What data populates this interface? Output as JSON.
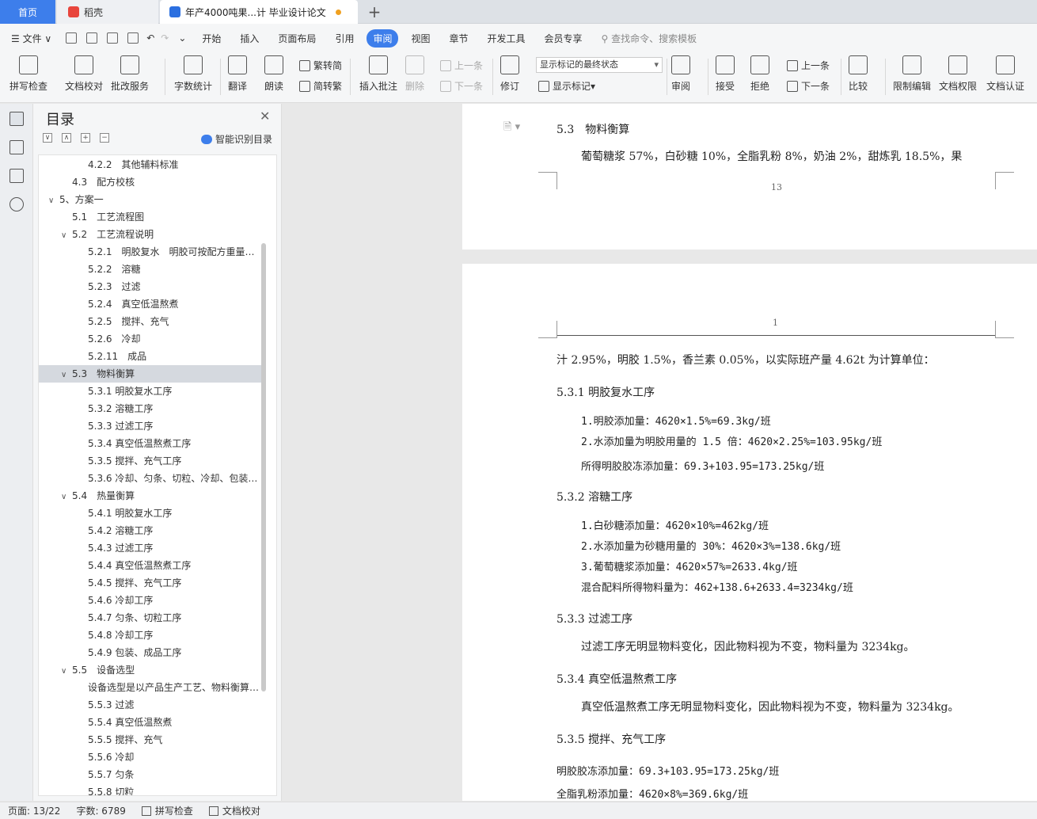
{
  "tabs": {
    "home": "首页",
    "daoke": "稻壳",
    "doc": "年产4000吨果...计 毕业设计论文"
  },
  "menu": [
    "文件",
    "开始",
    "插入",
    "页面布局",
    "引用",
    "审阅",
    "视图",
    "章节",
    "开发工具",
    "会员专享"
  ],
  "menu_search": "查找命令、搜索模板",
  "ribbon": {
    "spell": "拼写检查",
    "proof": "文档校对",
    "batch": "批改服务",
    "wordcount": "字数统计",
    "translate": "翻译",
    "read": "朗读",
    "trad": "繁转简",
    "simp": "简转繁",
    "insert_comment": "插入批注",
    "delete": "删除",
    "prev1": "上一条",
    "next1": "下一条",
    "revise": "修订",
    "markup_state": "显示标记的最终状态",
    "show_markup": "显示标记",
    "review": "审阅",
    "accept": "接受",
    "reject": "拒绝",
    "prev2": "上一条",
    "next2": "下一条",
    "compare": "比较",
    "restrict": "限制编辑",
    "rights": "文档权限",
    "certify": "文档认证"
  },
  "toc": {
    "title": "目录",
    "smart": "智能识别目录",
    "items": [
      {
        "text": "4.2.2　其他辅料标准",
        "level": 3,
        "caret": ""
      },
      {
        "text": "4.3　配方校核",
        "level": 2,
        "caret": ""
      },
      {
        "text": "5、方案一",
        "level": 1,
        "caret": "∨"
      },
      {
        "text": "5.1　工艺流程图",
        "level": 2,
        "caret": ""
      },
      {
        "text": "5.2　工艺流程说明",
        "level": 2,
        "caret": "∨"
      },
      {
        "text": "5.2.1　明胶复水　明胶可按配方重量…",
        "level": 3,
        "caret": ""
      },
      {
        "text": "5.2.2　溶糖",
        "level": 3,
        "caret": ""
      },
      {
        "text": "5.2.3　过滤",
        "level": 3,
        "caret": ""
      },
      {
        "text": "5.2.4　真空低温熬煮",
        "level": 3,
        "caret": ""
      },
      {
        "text": "5.2.5　搅拌、充气",
        "level": 3,
        "caret": ""
      },
      {
        "text": "5.2.6　冷却",
        "level": 3,
        "caret": ""
      },
      {
        "text": "5.2.11　成品",
        "level": 3,
        "caret": ""
      },
      {
        "text": "5.3　物料衡算",
        "level": 2,
        "caret": "∨"
      },
      {
        "text": "5.3.1 明胶复水工序",
        "level": 3,
        "caret": ""
      },
      {
        "text": "5.3.2 溶糖工序",
        "level": 3,
        "caret": ""
      },
      {
        "text": "5.3.3 过滤工序",
        "level": 3,
        "caret": ""
      },
      {
        "text": "5.3.4 真空低温熬煮工序",
        "level": 3,
        "caret": ""
      },
      {
        "text": "5.3.5 搅拌、充气工序",
        "level": 3,
        "caret": ""
      },
      {
        "text": "5.3.6 冷却、匀条、切粒、冷却、包装…",
        "level": 3,
        "caret": ""
      },
      {
        "text": "5.4　热量衡算",
        "level": 2,
        "caret": "∨"
      },
      {
        "text": "5.4.1 明胶复水工序",
        "level": 3,
        "caret": ""
      },
      {
        "text": "5.4.2 溶糖工序",
        "level": 3,
        "caret": ""
      },
      {
        "text": "5.4.3 过滤工序",
        "level": 3,
        "caret": ""
      },
      {
        "text": "5.4.4 真空低温熬煮工序",
        "level": 3,
        "caret": ""
      },
      {
        "text": "5.4.5 搅拌、充气工序",
        "level": 3,
        "caret": ""
      },
      {
        "text": "5.4.6 冷却工序",
        "level": 3,
        "caret": ""
      },
      {
        "text": "5.4.7 匀条、切粒工序",
        "level": 3,
        "caret": ""
      },
      {
        "text": "5.4.8 冷却工序",
        "level": 3,
        "caret": ""
      },
      {
        "text": "5.4.9 包装、成品工序",
        "level": 3,
        "caret": ""
      },
      {
        "text": "5.5　设备选型",
        "level": 2,
        "caret": "∨"
      },
      {
        "text": "设备选型是以产品生产工艺、物料衡算…",
        "level": 3,
        "caret": ""
      },
      {
        "text": "5.5.3 过滤",
        "level": 3,
        "caret": ""
      },
      {
        "text": "5.5.4 真空低温熬煮",
        "level": 3,
        "caret": ""
      },
      {
        "text": "5.5.5 搅拌、充气",
        "level": 3,
        "caret": ""
      },
      {
        "text": "5.5.6 冷却",
        "level": 3,
        "caret": ""
      },
      {
        "text": "5.5.7 匀条",
        "level": 3,
        "caret": ""
      },
      {
        "text": "5.5.8 切粒",
        "level": 3,
        "caret": ""
      }
    ],
    "selected_index": 12
  },
  "page1": {
    "heading": "5.3　物料衡算",
    "line": "葡萄糖浆 57%，白砂糖 10%，全脂乳粉 8%，奶油 2%，甜炼乳 18.5%，果",
    "page_number": "13"
  },
  "page2": {
    "page_number": "1",
    "intro": "汁 2.95%，明胶 1.5%，香兰素 0.05%，以实际班产量 4.62t 为计算单位：",
    "s531": "5.3.1  明胶复水工序",
    "s531_l1": "1.明胶添加量：4620×1.5%=69.3kg/班",
    "s531_l2": "2.水添加量为明胶用量的 1.5 倍：4620×2.25%=103.95kg/班",
    "s531_l3": "所得明胶胶冻添加量：69.3+103.95=173.25kg/班",
    "s532": "5.3.2  溶糖工序",
    "s532_l1": "1.白砂糖添加量：4620×10%=462kg/班",
    "s532_l2": "2.水添加量为砂糖用量的 30%：4620×3%=138.6kg/班",
    "s532_l3": "3.葡萄糖浆添加量：4620×57%=2633.4kg/班",
    "s532_l4": "混合配料所得物料量为：462+138.6+2633.4=3234kg/班",
    "s533": "5.3.3  过滤工序",
    "s533_l1": "过滤工序无明显物料变化，因此物料视为不变，物料量为 3234kg。",
    "s534": "5.3.4  真空低温熬煮工序",
    "s534_l1": "真空低温熬煮工序无明显物料变化，因此物料视为不变，物料量为 3234kg。",
    "s535": "5.3.5  搅拌、充气工序",
    "s535_l1": "明胶胶冻添加量：69.3+103.95=173.25kg/班",
    "s535_l2": "全脂乳粉添加量：4620×8%=369.6kg/班"
  },
  "status": {
    "page": "页面: 13/22",
    "words": "字数: 6789",
    "spell": "拼写检查",
    "proof": "文档校对"
  },
  "colors": {
    "accent": "#3d7eeb"
  }
}
